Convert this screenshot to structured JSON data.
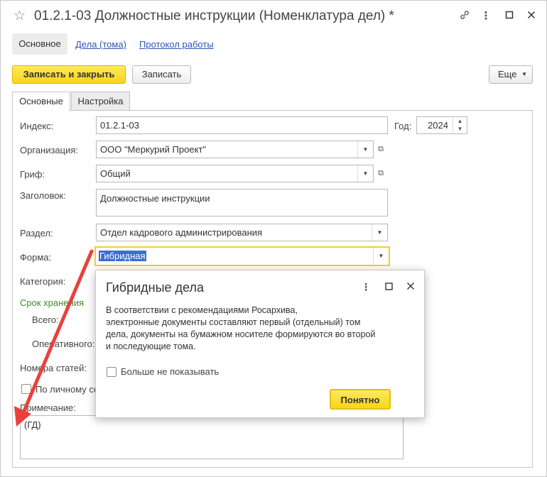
{
  "window": {
    "title": "01.2.1-03 Должностные инструкции (Номенклатура дел) *"
  },
  "nav": {
    "active": "Основное",
    "links": [
      "Дела (тома)",
      "Протокол работы"
    ]
  },
  "toolbar": {
    "save_close_label": "Записать и закрыть",
    "save_label": "Записать",
    "more_label": "Еще"
  },
  "tabs": [
    "Основные",
    "Настройка"
  ],
  "form": {
    "index_label": "Индекс:",
    "index_value": "01.2.1-03",
    "year_label": "Год:",
    "year_value": "2024",
    "org_label": "Организация:",
    "org_value": "ООО \"Меркурий Проект\"",
    "grif_label": "Гриф:",
    "grif_value": "Общий",
    "heading_label": "Заголовок:",
    "heading_value": "Должностные инструкции",
    "section_label": "Раздел:",
    "section_value": "Отдел кадрового администрирования",
    "form_label": "Форма:",
    "form_value": "Гибридная",
    "category_label": "Категория:",
    "storage_label": "Срок хранения",
    "total_label": "Всего:",
    "operative_label": "Оперативного:",
    "articles_label": "Номера статей:",
    "personal_label": "По личному со",
    "note_label": "Примечание:",
    "note_value": "(ГД)"
  },
  "dialog": {
    "title": "Гибридные дела",
    "text_lines": [
      "В соответствии с рекомендациями Росархива,",
      "электронные документы составляют первый (отдельный) том",
      "дела, документы на бумажном носителе формируются во второй",
      "и последующие тома."
    ],
    "checkbox_label": "Больше не показывать",
    "ok_label": "Понятно"
  },
  "colors": {
    "accent_yellow": "#f7d51a",
    "link_blue": "#2b56b3",
    "green_label": "#3b8d2a",
    "arrow_red": "#e8413c",
    "selection": "#3a6ed1"
  }
}
